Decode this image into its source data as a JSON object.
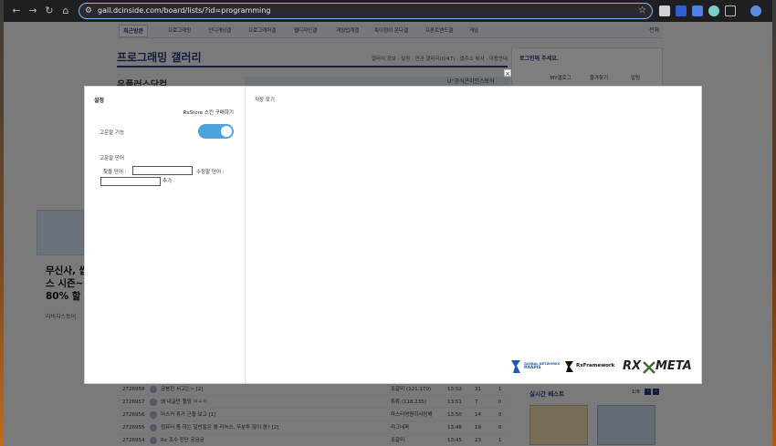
{
  "browser": {
    "url": "gall.dcinside.com/board/lists/?id=programming"
  },
  "gnb": {
    "recent_label": "최근방문",
    "items": [
      "프로그래밍",
      "인디게임갤",
      "프로그래머갤",
      "웹디자인갤",
      "게임업계갤",
      "특이점이 온다갤",
      "프론트엔드갤",
      "게임"
    ],
    "right_link": "전체"
  },
  "gallery": {
    "title": "프로그래밍 갤러리",
    "header_links": "갤러리 정보 · 설정 · 연관 갤러리(0/47) · 갤주소 복사 · 이용안내",
    "banner_title": "유플러스닷컴",
    "ad_band_text": "U⁺공식온라인스토어"
  },
  "login": {
    "title": "로그인해 주세요.",
    "buttons": [
      "MY갤로그",
      "즐겨찾기",
      "알림"
    ]
  },
  "side": {
    "headline": "무신사, 쌉캉스 시즌~ 80% 할",
    "source": "라비지스토어"
  },
  "list": {
    "rows": [
      {
        "num": "2726958",
        "title": "금붕진 서고는~ [2]",
        "writer": "조갈미 (121.170)",
        "date": "13:52",
        "views": "31",
        "rec": "1"
      },
      {
        "num": "2726957",
        "title": "왜 내글만 혈링 ㅇㅅㅇ",
        "writer": "류류 (118.235)",
        "date": "13:51",
        "views": "7",
        "rec": "0"
      },
      {
        "num": "2726956",
        "title": "머스커 휴가 근황 보고 [1]",
        "writer": "마스터영원히사랑해",
        "date": "13:50",
        "views": "14",
        "rec": "0"
      },
      {
        "num": "2726955",
        "title": "컴퓨터 좀 하는 일반들은 왜 리눅스, 우분투 많이 씀? [2]",
        "writer": "리그네파",
        "date": "13:48",
        "views": "19",
        "rec": "0"
      },
      {
        "num": "2726954",
        "title": "Rx 조수 진단 궁금궁",
        "writer": "조갈미",
        "date": "13:45",
        "views": "23",
        "rec": "1"
      }
    ]
  },
  "best": {
    "title": "실시간 베스트",
    "page": "1/8"
  },
  "modal": {
    "settings_title": "설정",
    "skin_link": "RxStore 스킨 구매하기",
    "feature_label": "고운말 기능",
    "toggle_on": true,
    "word_section": "고운말 단어",
    "find_label": "찾을 단어 :",
    "replace_label": "수정할 단어 :",
    "add_label": "추가",
    "find_value": "",
    "replace_value": "",
    "right_title": "저장 모기",
    "logos": {
      "rxapis_lines": [
        "GLOBAL NETWORKS",
        "RXAPIS"
      ],
      "rxframework": "RxFramework",
      "rx": "RX",
      "meta": "META"
    }
  },
  "colors": {
    "accent": "#29367c",
    "toggle": "#4aa3df",
    "omnibox_border": "#8ab4f8"
  }
}
